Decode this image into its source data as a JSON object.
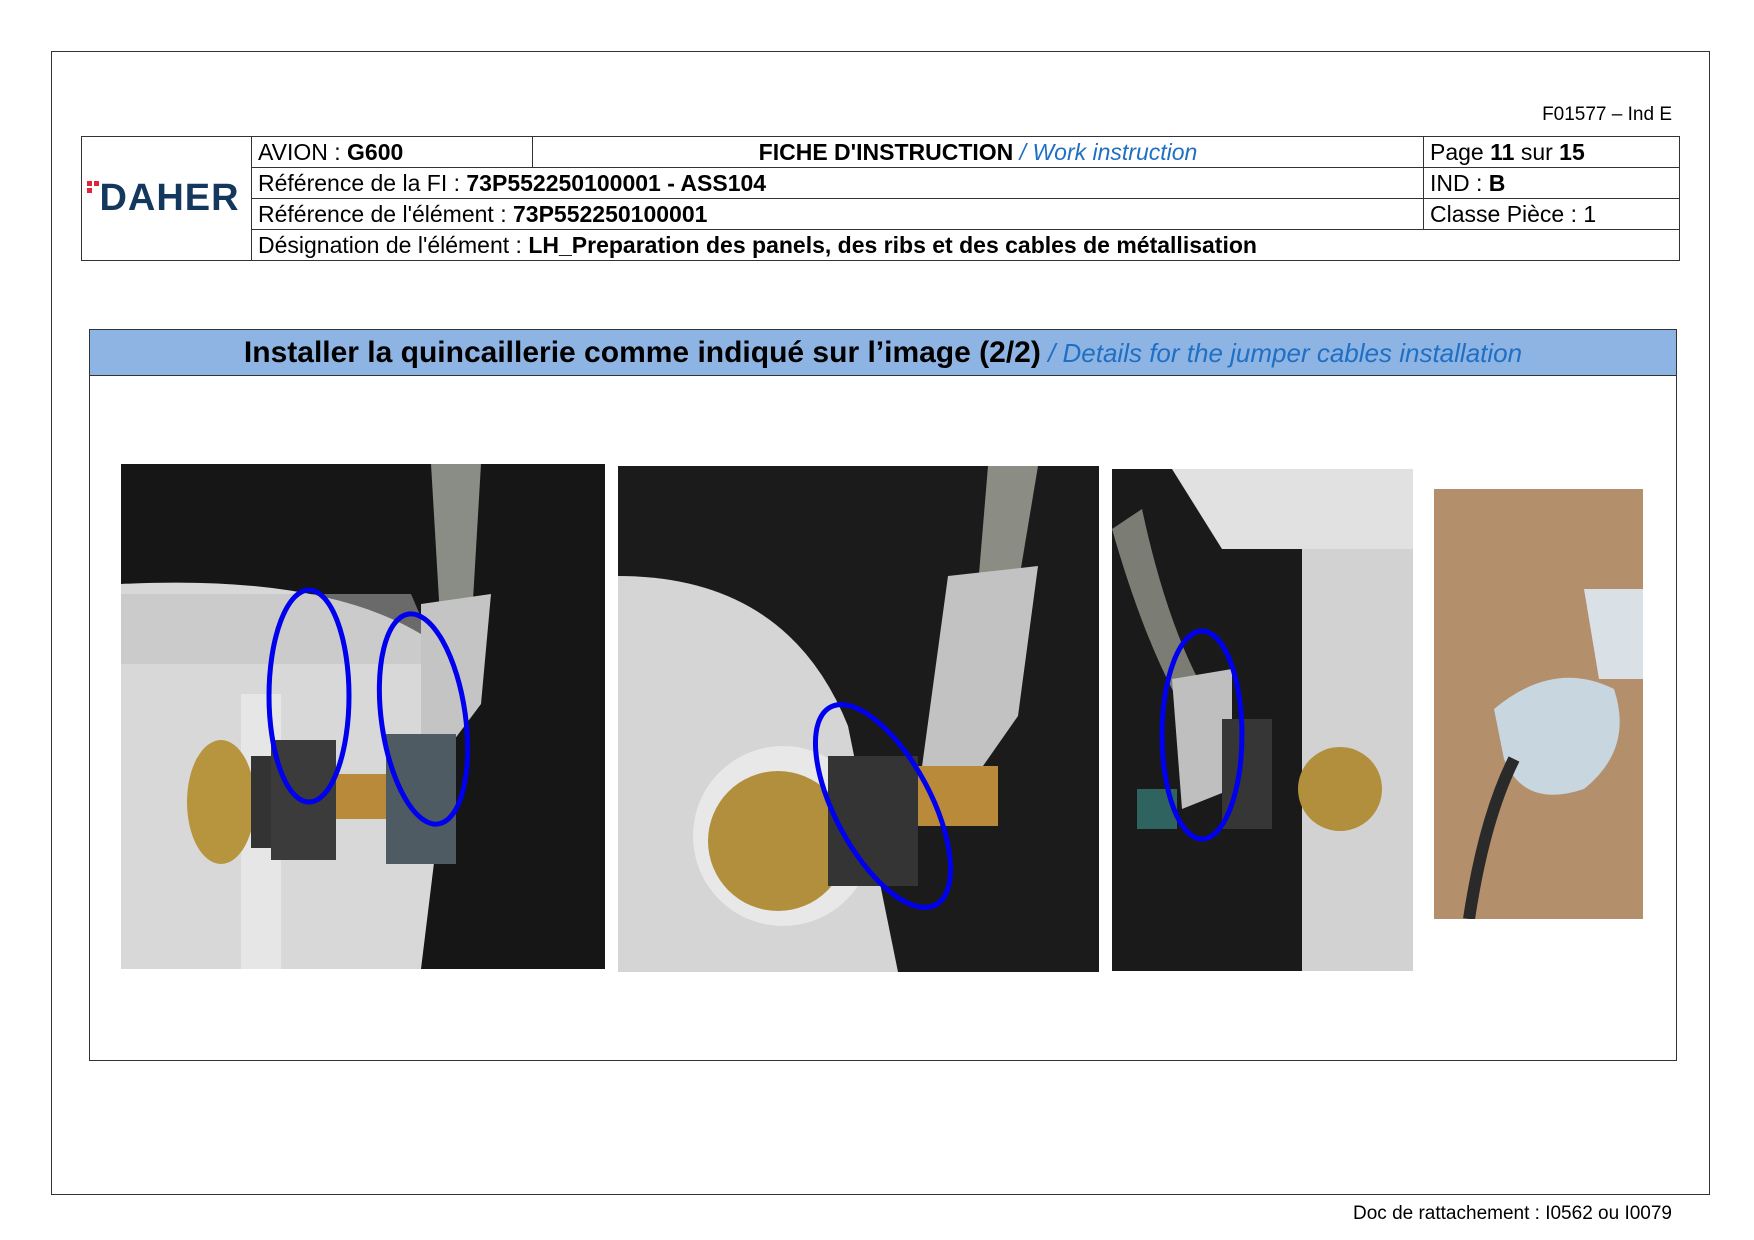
{
  "doc_ref": "F01577 – Ind E",
  "logo_text": "DAHER",
  "header": {
    "avion_label": "AVION : ",
    "avion_value": "G600",
    "title": "FICHE D'INSTRUCTION",
    "title_en": " / Work instruction",
    "page_label": "Page ",
    "page_current": "11",
    "page_sep": " sur ",
    "page_total": "15",
    "ref_fi_label": "Référence de la FI : ",
    "ref_fi_value": "73P552250100001 - ASS104",
    "ind_label": "IND : ",
    "ind_value": "B",
    "ref_elem_label": "Référence de l'élément : ",
    "ref_elem_value": "73P552250100001",
    "classe_label": "Classe Pièce : 1",
    "designation_label": "Désignation de l'élément : ",
    "designation_value": "LH_Preparation des panels, des ribs et des cables de métallisation"
  },
  "section": {
    "title": "Installer la quincaillerie comme indiqué sur l’image (2/2)",
    "title_en": " / Details for the jumper cables installation"
  },
  "colors": {
    "highlight": "#0000ee",
    "band": "#8eb4e3",
    "accent": "#1f6fc4",
    "logo": "#14375e"
  },
  "footer": "Doc de rattachement : I0562 ou I0079"
}
